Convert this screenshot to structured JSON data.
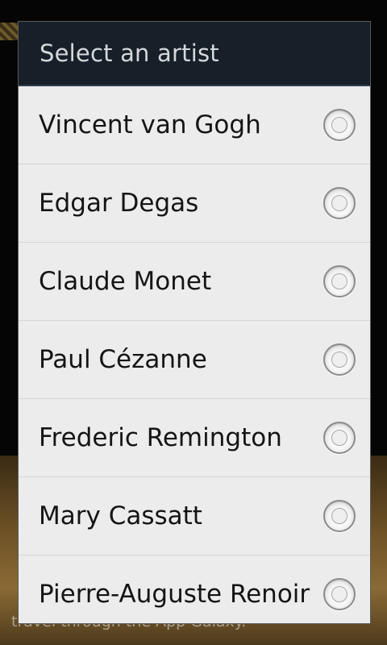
{
  "background": {
    "banner_text": "travel through the App Galaxy."
  },
  "dialog": {
    "title": "Select an artist",
    "items": [
      {
        "label": "Vincent van Gogh",
        "selected": false
      },
      {
        "label": "Edgar Degas",
        "selected": false
      },
      {
        "label": "Claude Monet",
        "selected": false
      },
      {
        "label": "Paul Cézanne",
        "selected": false
      },
      {
        "label": "Frederic Remington",
        "selected": false
      },
      {
        "label": "Mary Cassatt",
        "selected": false
      },
      {
        "label": "Pierre-Auguste Renoir",
        "selected": false
      }
    ]
  }
}
